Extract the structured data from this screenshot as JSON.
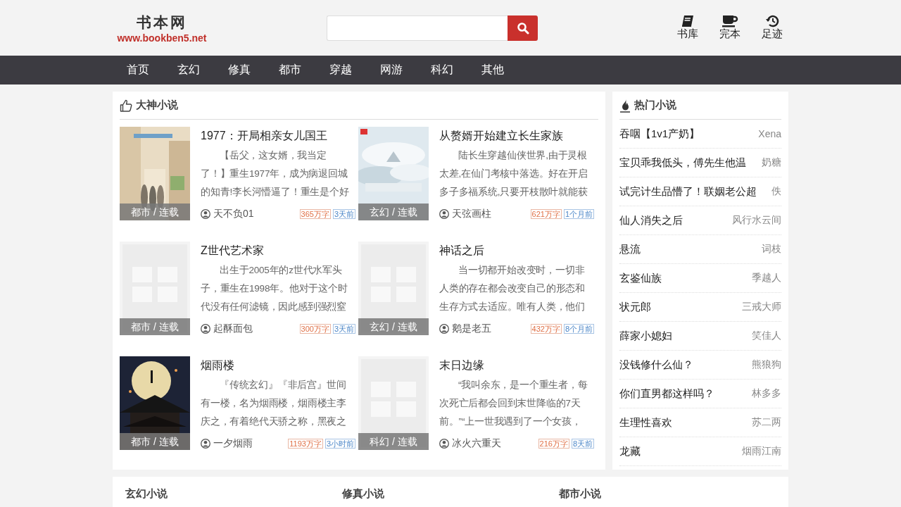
{
  "header": {
    "logo": "书本网",
    "url": "www.bookben5.net",
    "links": [
      {
        "label": "书库"
      },
      {
        "label": "完本"
      },
      {
        "label": "足迹"
      }
    ]
  },
  "nav": [
    {
      "label": "首页"
    },
    {
      "label": "玄幻"
    },
    {
      "label": "修真"
    },
    {
      "label": "都市"
    },
    {
      "label": "穿越"
    },
    {
      "label": "网游"
    },
    {
      "label": "科幻"
    },
    {
      "label": "其他"
    }
  ],
  "featured": {
    "title": "大神小说",
    "books": [
      {
        "title": "1977：开局相亲女儿国王",
        "description": "【岳父，这女婿，我当定了！】重生1977年，成为病退回城的知青!李长河懵逼了！重生是个好",
        "author": "天不负01",
        "words": "365万字",
        "updated": "3天前",
        "category": "都市 / 连载",
        "kind": "picture"
      },
      {
        "title": "从赘婿开始建立长生家族",
        "description": "陆长生穿越仙侠世界,由于灵根太差,在仙门考核中落选。好在开启多子多福系统,只要开枝散叶就能获",
        "author": "天弦画柱",
        "words": "621万字",
        "updated": "1个月前",
        "category": "玄幻 / 连载",
        "kind": "picture"
      },
      {
        "title": "Z世代艺术家",
        "description": "出生于2005年的z世代水军头子，重生在1998年。他对于这个时代没有任何滤镜，因此感到强烈窒",
        "author": "起酥面包",
        "words": "300万字",
        "updated": "3天前",
        "category": "都市 / 连载",
        "kind": "placeholder"
      },
      {
        "title": "神话之后",
        "description": "当一切都开始改变时，一切非人类的存在都会改变自己的形态和生存方式去适应。唯有人类，他们",
        "author": "鹅是老五",
        "words": "432万字",
        "updated": "8个月前",
        "category": "玄幻 / 连载",
        "kind": "placeholder"
      },
      {
        "title": "烟雨楼",
        "description": "『传统玄幻』『非后宫』世间有一楼，名为烟雨楼，烟雨楼主李庆之，有着绝代天骄之称，黑夜之",
        "author": "一夕烟雨",
        "words": "1193万字",
        "updated": "3小时前",
        "category": "都市 / 连载",
        "kind": "picture"
      },
      {
        "title": "末日边缘",
        "description": "“我叫余东，是一个重生者，每次死亡后都会回到末世降临的7天前。”“上一世我遇到了一个女孩，",
        "author": "冰火六重天",
        "words": "216万字",
        "updated": "8天前",
        "category": "科幻 / 连载",
        "kind": "placeholder"
      }
    ]
  },
  "hot": {
    "title": "热门小说",
    "items": [
      {
        "title": "吞咽【1v1产奶】",
        "author": "Xena"
      },
      {
        "title": "宝贝乖我低头，傅先生他温",
        "author": "奶糖"
      },
      {
        "title": "试完计生品懵了！联姻老公超",
        "author": "佚"
      },
      {
        "title": "仙人消失之后",
        "author": "风行水云间"
      },
      {
        "title": "悬流",
        "author": "词枝"
      },
      {
        "title": "玄鉴仙族",
        "author": "季越人"
      },
      {
        "title": "状元郎",
        "author": "三戒大师"
      },
      {
        "title": "薛家小媳妇",
        "author": "笑佳人"
      },
      {
        "title": "没钱修什么仙？",
        "author": "熊狼狗"
      },
      {
        "title": "你们直男都这样吗？",
        "author": "林多多"
      },
      {
        "title": "生理性喜欢",
        "author": "苏二两"
      },
      {
        "title": "龙藏",
        "author": "烟雨江南"
      }
    ]
  },
  "sections": [
    {
      "title": "玄幻小说"
    },
    {
      "title": "修真小说"
    },
    {
      "title": "都市小说"
    }
  ]
}
